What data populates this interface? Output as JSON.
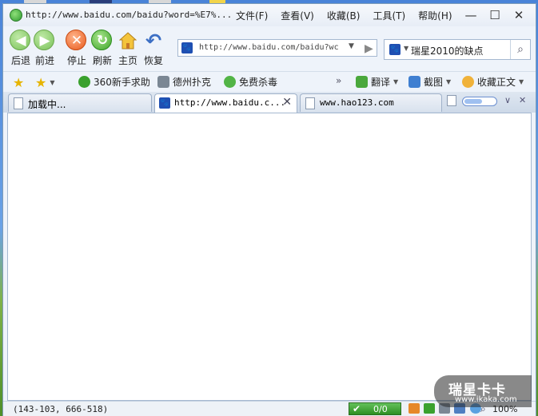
{
  "window": {
    "title": "http://www.baidu.com/baidu?word=%E7%...",
    "menu": [
      "文件(F)",
      "查看(V)",
      "收藏(B)",
      "工具(T)",
      "帮助(H)"
    ],
    "controls": {
      "minimize": "—",
      "maximize": "☐",
      "close": "✕"
    }
  },
  "toolbar": {
    "back": "后退",
    "forward": "前进",
    "stop": "停止",
    "refresh": "刷新",
    "home": "主页",
    "restore": "恢复"
  },
  "address": {
    "value": "http://www.baidu.com/baidu?wc"
  },
  "search": {
    "value": "瑞星2010的缺点"
  },
  "favorites": {
    "items": [
      "360新手求助",
      "德州扑克",
      "免费杀毒"
    ],
    "tools": [
      "翻译",
      "截图",
      "收藏正文"
    ]
  },
  "tabs": [
    {
      "label": "加载中...",
      "active": false
    },
    {
      "label": "http://www.baidu.c...",
      "active": true
    },
    {
      "label": "www.hao123.com",
      "active": false
    }
  ],
  "status": {
    "coords": "(143-103, 666-518)",
    "counter": "0/0",
    "zoom": "100%"
  },
  "watermark": {
    "line1": "瑞星卡卡",
    "line2": "www.ikaka.com"
  },
  "colors": {
    "accent": "#1f4fb2",
    "status_green": "#3aa12e"
  }
}
